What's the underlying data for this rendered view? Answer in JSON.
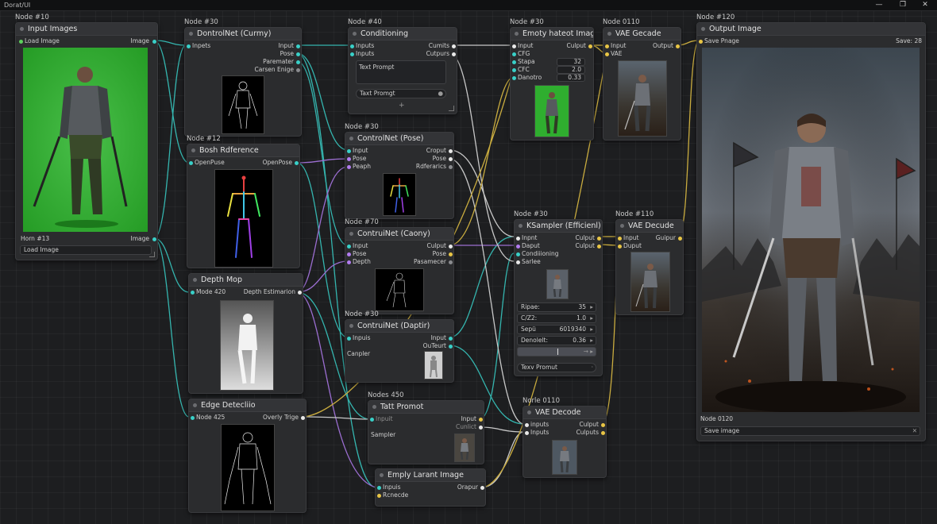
{
  "window": {
    "title": "Dorat/UI",
    "minimize": "—",
    "maximize": "❐",
    "close": "✕"
  },
  "nodes": {
    "input_images": {
      "label": "Node #10",
      "title": "Input Images",
      "load_image": "Load Image",
      "image_out": "Image",
      "footer_label": "Horn #13",
      "footer_out": "Image",
      "load_field": "Load Image"
    },
    "controlnet_canny_top": {
      "label": "Node #30",
      "title": "DontrolNet (Curmy)",
      "in_inputs": "Inpets",
      "outs": [
        "Input",
        "Pose",
        "Paremater",
        "Carsen Enige"
      ]
    },
    "pose_reference": {
      "label": "Node #12",
      "title": "Bosh Rdference",
      "in": "OpenPuse",
      "out": "OpenPose"
    },
    "depth_map": {
      "label": "",
      "title": "Depth Mop",
      "in": "Mode 420",
      "out": "Depth Estimarion"
    },
    "edge_detection": {
      "label": "",
      "title": "Edge Detecliio",
      "in": "Node 425",
      "out": "Overly Trige"
    },
    "conditioning": {
      "label": "Node #40",
      "title": "Conditioning",
      "ins": [
        "Inputs",
        "Inputs"
      ],
      "outs": [
        "Cumits",
        "Cutpurs"
      ],
      "text_prompt": "Text Prompt",
      "text_prompt_field": "Taxt Promgt",
      "plus": "+"
    },
    "controlnet_pose": {
      "label": "Node #30",
      "title": "ControlNet (Pose)",
      "ins": [
        "Input",
        "Pose",
        "Peaph"
      ],
      "outs": [
        "Croput",
        "Pose",
        "Rdferarics"
      ]
    },
    "controlnet_canny": {
      "label": "Node #70",
      "title": "ContruiNet (Caony)",
      "ins": [
        "Input",
        "Pose",
        "Depth"
      ],
      "outs": [
        "Culput",
        "Pose",
        "Pasamecer"
      ]
    },
    "controlnet_depth": {
      "label": "Node #30",
      "title": "ContruiNet (Daptir)",
      "in": "Inpuis",
      "outs": [
        "Input",
        "OuTeurt"
      ],
      "sampler": "Canpler"
    },
    "empty_latent_top": {
      "label": "Node #30",
      "title": "Emoty hateot Image",
      "ins": [
        "Input",
        "CFG",
        "Stapa",
        "CFC",
        "Danotro"
      ],
      "out": "Culput",
      "values": [
        "32",
        "2.0",
        "0.33"
      ]
    },
    "vae_decode_top": {
      "label": "Node 0110",
      "title": "VAE Gecade",
      "ins": [
        "Input",
        "VAE"
      ],
      "out": "Output"
    },
    "output_image": {
      "label": "Node #120",
      "title": "Output Image",
      "save_label": "Save Pnage",
      "save_out": "Save: 28",
      "footer_label": "Node 0120",
      "save_field": "Save image",
      "save_field_x": "✕"
    },
    "ksampler": {
      "label": "Node #30",
      "title": "KSampler (Efficienl)",
      "ins": [
        "Inpnt",
        "Daput",
        "Condiiioning",
        "Sarlee"
      ],
      "outs": [
        "Culput",
        "Culput"
      ],
      "fields": [
        {
          "name": "Ripae:",
          "value": "35"
        },
        {
          "name": "C/Z2:",
          "value": "1.0"
        },
        {
          "name": "Sepü",
          "value": "6019340"
        },
        {
          "name": "Denolelt:",
          "value": "0.36"
        }
      ],
      "text_field": "Texv Promut"
    },
    "vae_decode_mid": {
      "label": "Node #110",
      "title": "VAE Decude",
      "ins": [
        "Input",
        "Duput"
      ],
      "out": "Guipur"
    },
    "text_prompt": {
      "label": "Nodes 450",
      "title": "Tatt Promot",
      "in": "Inpuit",
      "outs": [
        "Input",
        "Cunlict"
      ],
      "sampler": "Sampler"
    },
    "empty_latent_bottom": {
      "label": "",
      "title": "Emply Larant Image",
      "ins": [
        "Inpuis",
        "Rcnecde"
      ],
      "out": "Orapur"
    },
    "vae_decode_bottom": {
      "label": "Norle 0110",
      "title": "VAE Decode",
      "ins": [
        "inputs",
        "Inputs"
      ],
      "outs": [
        "Culput",
        "Culputs"
      ]
    }
  },
  "colors": {
    "wire_cyan": "#39d0c8",
    "wire_yellow": "#e8c545",
    "wire_purple": "#b27cf0",
    "wire_white": "#e6e6e6",
    "green_screen": "#2fae2f"
  }
}
